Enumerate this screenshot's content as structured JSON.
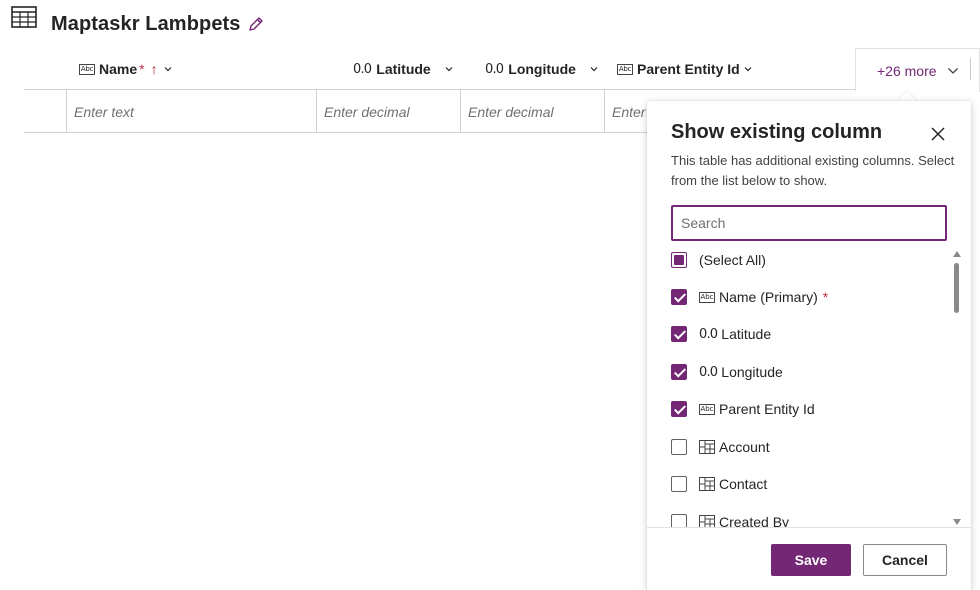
{
  "header": {
    "table_icon": "table-grid-icon",
    "title": "Maptaskr Lambpets",
    "edit_icon": "pencil-icon"
  },
  "columns": [
    {
      "type_icon": "Abc",
      "label": "Name",
      "required_mark": "*",
      "sort_icon": "↑"
    },
    {
      "type_icon": "0.0",
      "label": "Latitude"
    },
    {
      "type_icon": "0.0",
      "label": "Longitude"
    },
    {
      "type_icon": "Abc",
      "label": "Parent Entity Id"
    }
  ],
  "more_button": {
    "label": "+26 more"
  },
  "new_row": {
    "name_placeholder": "Enter text",
    "latitude_placeholder": "Enter decimal",
    "longitude_placeholder": "Enter decimal",
    "parent_placeholder": "Enter"
  },
  "panel": {
    "title": "Show existing column",
    "description": "This table has additional existing columns. Select from the list below to show.",
    "search_placeholder": "Search",
    "items": [
      {
        "label": "(Select All)",
        "state": "partial",
        "icon": ""
      },
      {
        "label": "Name (Primary)",
        "state": "checked",
        "icon": "Abc",
        "required_mark": "*"
      },
      {
        "label": "Latitude",
        "state": "checked",
        "icon": "0.0"
      },
      {
        "label": "Longitude",
        "state": "checked",
        "icon": "0.0"
      },
      {
        "label": "Parent Entity Id",
        "state": "checked",
        "icon": "Abc"
      },
      {
        "label": "Account",
        "state": "unchecked",
        "icon": "lookup-icon"
      },
      {
        "label": "Contact",
        "state": "unchecked",
        "icon": "lookup-icon"
      },
      {
        "label": "Created By",
        "state": "unchecked",
        "icon": "lookup-icon"
      }
    ],
    "save_label": "Save",
    "cancel_label": "Cancel"
  },
  "colors": {
    "accent": "#742774",
    "required": "#c4314b",
    "sort": "#a4262c"
  }
}
